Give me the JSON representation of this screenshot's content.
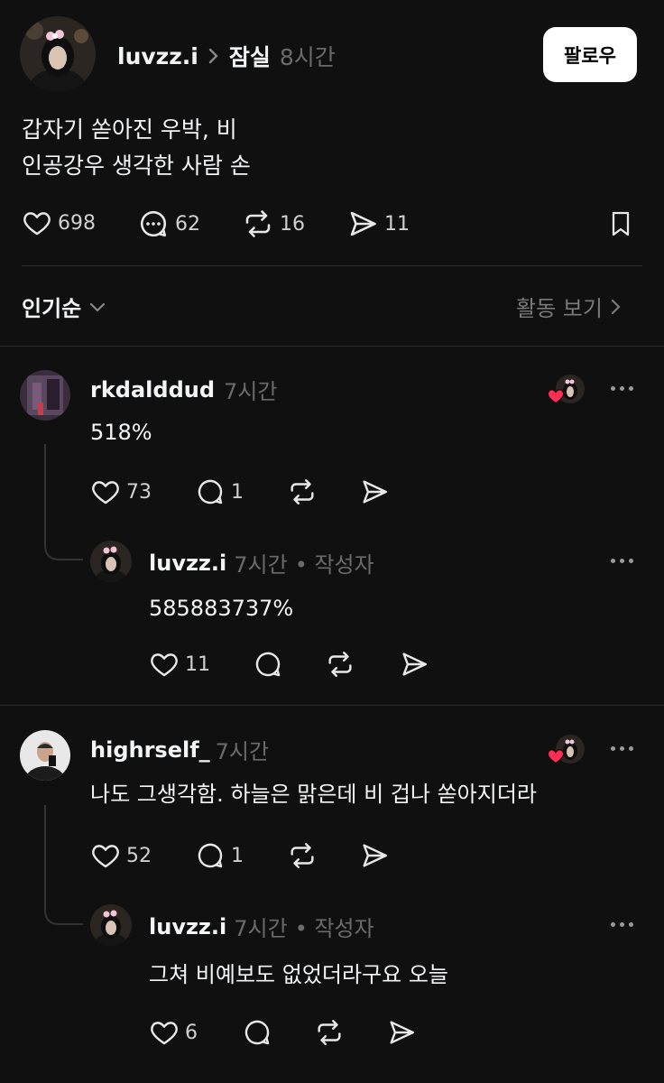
{
  "post": {
    "author": "luvzz.i",
    "location": "잠실",
    "time": "8시간",
    "follow_label": "팔로우",
    "lines": [
      "갑자기 쏟아진 우박, 비",
      "인공강우 생각한 사람 손"
    ],
    "likes": "698",
    "comments": "62",
    "reposts": "16",
    "shares": "11"
  },
  "sort_bar": {
    "sort_label": "인기순",
    "activity_label": "활동 보기"
  },
  "comments": [
    {
      "author": "rkdalddud",
      "time": "7시간",
      "text": "518%",
      "likes": "73",
      "replies": "1",
      "reply": {
        "author": "luvzz.i",
        "time": "7시간",
        "author_tag": "• 작성자",
        "text": "585883737%",
        "likes": "11"
      }
    },
    {
      "author": "highrself_",
      "time": "7시간",
      "text": "나도 그생각함. 하늘은 맑은데 비 겁나 쏟아지더라",
      "likes": "52",
      "replies": "1",
      "reply": {
        "author": "luvzz.i",
        "time": "7시간",
        "author_tag": "• 작성자",
        "text": "그쳐 비예보도 없었더라구요 오늘",
        "likes": "6"
      }
    }
  ],
  "colors": {
    "background": "#101010",
    "heart_badge": "#ff2d55",
    "divider": "#2a2a2a"
  }
}
